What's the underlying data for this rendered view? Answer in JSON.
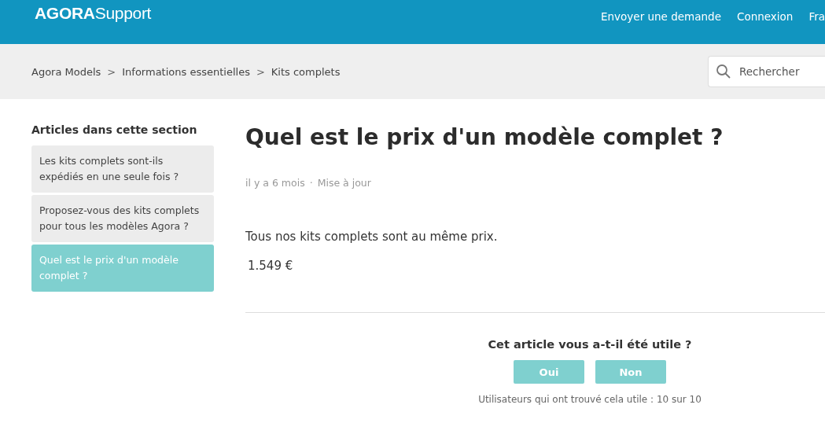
{
  "header": {
    "logo": "**AGORA**Support",
    "nav": [
      "Envoyer une demande",
      "Connexion",
      "Fra"
    ]
  },
  "breadcrumbs": {
    "items": [
      "Agora Models",
      "Informations essentielles",
      "Kits complets"
    ],
    "separators": [
      ">",
      ">"
    ]
  },
  "search": {
    "placeholder": "Rechercher"
  },
  "sidebar": {
    "title": "Articles dans cette section",
    "items": [
      {
        "label": "Les kits complets sont-ils expédiés en une seule fois ?",
        "selected": false
      },
      {
        "label": "Proposez-vous des kits complets pour tous les modèles Agora ?",
        "selected": false
      },
      {
        "label": "Quel est le prix d'un modèle complet ?",
        "selected": true
      }
    ]
  },
  "article": {
    "title": "Quel est le prix d'un modèle complet ?",
    "meta": [
      "il y a 6 mois",
      "Mise à jour"
    ],
    "meta_separator": "·",
    "body": [
      "Tous nos kits complets sont au même prix.",
      "1.549 €"
    ]
  },
  "feedback": {
    "question": "Cet article vous a-t-il été utile ?",
    "buttons": [
      "Oui",
      "Non"
    ],
    "summary": "Utilisateurs qui ont trouvé cela utile : 10 sur 10"
  }
}
